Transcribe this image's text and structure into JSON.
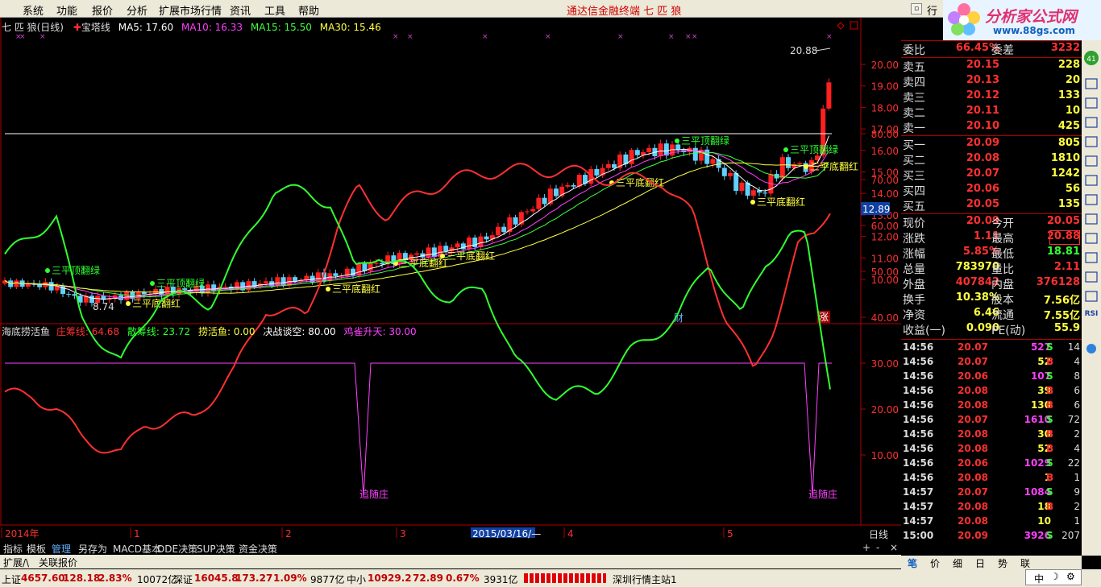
{
  "menu": [
    "系统",
    "功能",
    "报价",
    "分析",
    "扩展市场行情",
    "资讯",
    "工具",
    "帮助"
  ],
  "app_title": "通达信金融终端  七 匹 狼",
  "logo": {
    "site": "分析家公式网",
    "url": "www.88gs.com"
  },
  "main": {
    "stock_title": "七 匹 狼(日线)",
    "indicator_name": "宝塔线",
    "ma": [
      "MA5: 17.60",
      "MA10: 16.33",
      "MA15: 15.50",
      "MA30: 15.46"
    ],
    "ma_colors": [
      "#ffffff",
      "#ff40ff",
      "#40ff40",
      "#ffff40"
    ],
    "high_label": "20.88",
    "low_label": "8.74",
    "price_ticks": [
      "20.00",
      "19.00",
      "18.00",
      "17.00",
      "16.00",
      "15.00",
      "14.00",
      "13.00",
      "12.00",
      "11.00",
      "10.00"
    ],
    "current_price_badge": "12.89",
    "badges": {
      "cai": "财",
      "zhang": "涨"
    },
    "signals": [
      "三平顶翻绿",
      "三平底翻红",
      "追随庄"
    ]
  },
  "sub": {
    "name": "海底捞活鱼",
    "items": [
      {
        "label": "庄筹线",
        "value": "64.68",
        "color": "#ff3030"
      },
      {
        "label": "散筹线",
        "value": "23.72",
        "color": "#30ff30"
      },
      {
        "label": "捞活鱼",
        "value": "0.00",
        "color": "#ffff40"
      },
      {
        "label": "决战谈空",
        "value": "80.00",
        "color": "#ffffff"
      },
      {
        "label": "鸡雀升天",
        "value": "30.00",
        "color": "#ff40ff"
      }
    ],
    "ticks": [
      "80.00",
      "70.00",
      "60.00",
      "50.00",
      "40.00",
      "30.00",
      "20.00",
      "10.00"
    ]
  },
  "xaxis": {
    "labels": [
      "2014年",
      "1",
      "2",
      "3",
      "2015/03/16/—",
      "4",
      "5"
    ],
    "period": "日线"
  },
  "tabs_row1": [
    "指标",
    "模板",
    "管理",
    "另存为",
    "MACD基本",
    "DDE决策",
    "SUP决策",
    "资金决策"
  ],
  "tabs_row2": [
    "扩展/\\",
    "关联报价"
  ],
  "quote": {
    "ratio": {
      "label": "委比",
      "value": "66.45%",
      "label2": "委差",
      "value2": "3232"
    },
    "asks": [
      {
        "label": "卖五",
        "price": "20.15",
        "vol": "228"
      },
      {
        "label": "卖四",
        "price": "20.13",
        "vol": "20"
      },
      {
        "label": "卖三",
        "price": "20.12",
        "vol": "133"
      },
      {
        "label": "卖二",
        "price": "20.11",
        "vol": "10"
      },
      {
        "label": "卖一",
        "price": "20.10",
        "vol": "425"
      }
    ],
    "bids": [
      {
        "label": "买一",
        "price": "20.09",
        "vol": "805"
      },
      {
        "label": "买二",
        "price": "20.08",
        "vol": "1810"
      },
      {
        "label": "买三",
        "price": "20.07",
        "vol": "1242"
      },
      {
        "label": "买四",
        "price": "20.06",
        "vol": "56"
      },
      {
        "label": "买五",
        "price": "20.05",
        "vol": "135"
      }
    ],
    "stats": [
      {
        "l1": "现价",
        "v1": "20.09",
        "l2": "今开",
        "v2": "20.05"
      },
      {
        "l1": "涨跌",
        "v1": "1.11",
        "l2": "最高",
        "v2": "20.88"
      },
      {
        "l1": "涨幅",
        "v1": "5.85%",
        "l2": "最低",
        "v2": "18.81"
      },
      {
        "l1": "总量",
        "v1": "783970",
        "l2": "量比",
        "v2": "2.11"
      },
      {
        "l1": "外盘",
        "v1": "407842",
        "l2": "内盘",
        "v2": "376128"
      },
      {
        "l1": "换手",
        "v1": "10.38%",
        "l2": "股本",
        "v2": "7.56亿"
      },
      {
        "l1": "净资",
        "v1": "6.46",
        "l2": "流通",
        "v2": "7.55亿"
      },
      {
        "l1": "收益(一)",
        "v1": "0.090",
        "l2": "PE(动)",
        "v2": "55.9"
      }
    ],
    "ticks": [
      {
        "t": "14:56",
        "p": "20.07",
        "v": "527",
        "bs": "S",
        "n": "14"
      },
      {
        "t": "14:56",
        "p": "20.07",
        "v": "52",
        "bs": "B",
        "n": "4"
      },
      {
        "t": "14:56",
        "p": "20.06",
        "v": "107",
        "bs": "S",
        "n": "8"
      },
      {
        "t": "14:56",
        "p": "20.08",
        "v": "39",
        "bs": "B",
        "n": "6"
      },
      {
        "t": "14:56",
        "p": "20.08",
        "v": "130",
        "bs": "B",
        "n": "6"
      },
      {
        "t": "14:56",
        "p": "20.07",
        "v": "1610",
        "bs": "S",
        "n": "72"
      },
      {
        "t": "14:56",
        "p": "20.08",
        "v": "30",
        "bs": "B",
        "n": "2"
      },
      {
        "t": "14:56",
        "p": "20.08",
        "v": "52",
        "bs": "B",
        "n": "4"
      },
      {
        "t": "14:56",
        "p": "20.06",
        "v": "1029",
        "bs": "S",
        "n": "22"
      },
      {
        "t": "14:56",
        "p": "20.08",
        "v": "1",
        "bs": "B",
        "n": "1"
      },
      {
        "t": "14:57",
        "p": "20.07",
        "v": "1084",
        "bs": "S",
        "n": "9"
      },
      {
        "t": "14:57",
        "p": "20.08",
        "v": "18",
        "bs": "B",
        "n": "2"
      },
      {
        "t": "14:57",
        "p": "20.08",
        "v": "10",
        "bs": "",
        "n": "1"
      },
      {
        "t": "15:00",
        "p": "20.09",
        "v": "3926",
        "bs": "S",
        "n": "207"
      }
    ],
    "tabs": [
      "笔",
      "价",
      "细",
      "日",
      "势",
      "联"
    ]
  },
  "status": {
    "sh": {
      "name": "上证",
      "v": "4657.60",
      "c": "128.18",
      "p": "2.83%",
      "amt": "10072亿"
    },
    "sz": {
      "name": "深证",
      "v": "16045.8",
      "c": "173.27",
      "p": "1.09%",
      "amt": "9877亿"
    },
    "zx": {
      "name": "中小",
      "v": "10929.2",
      "c": "72.89",
      "p": "0.67%",
      "amt": "3931亿"
    },
    "station": "深圳行情主站1",
    "ime": "中"
  },
  "chart_data": {
    "type": "candlestick",
    "indicator_series": [
      {
        "name": "庄筹线",
        "last": 64.68
      },
      {
        "name": "散筹线",
        "last": 23.72
      }
    ],
    "price_range": [
      8.74,
      20.88
    ],
    "ylim_sub": [
      0,
      85
    ]
  }
}
